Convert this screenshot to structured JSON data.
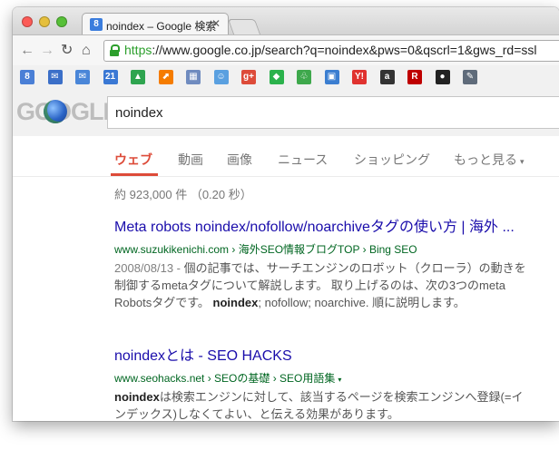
{
  "tab": {
    "title": "noindex – Google 検索",
    "favicon": "8",
    "close": "✕"
  },
  "omnibox": {
    "scheme": "https",
    "url_rest": "://www.google.co.jp/search?q=noindex&pws=0&qscrl=1&gws_rd=ssl"
  },
  "bookmarks": [
    {
      "icon": "g8-icon",
      "glyph": "8",
      "color": "#4a7fd6"
    },
    {
      "icon": "mail-icon",
      "glyph": "✉",
      "color": "#3b6fc8"
    },
    {
      "icon": "mail-icon",
      "glyph": "✉",
      "color": "#4a86d8"
    },
    {
      "icon": "calendar-icon",
      "glyph": "21",
      "color": "#3a78d4"
    },
    {
      "icon": "drive-icon",
      "glyph": "▲",
      "color": "#2ea44f"
    },
    {
      "icon": "analytics-icon",
      "glyph": "⬈",
      "color": "#f57c00"
    },
    {
      "icon": "tool-icon",
      "glyph": "▦",
      "color": "#6f8bbf"
    },
    {
      "icon": "user-icon",
      "glyph": "☺",
      "color": "#5aa0e0"
    },
    {
      "icon": "gplus-icon",
      "glyph": "g+",
      "color": "#dd4b39"
    },
    {
      "icon": "feedly-icon",
      "glyph": "◆",
      "color": "#2bb24c"
    },
    {
      "icon": "evernote-icon",
      "glyph": "♧",
      "color": "#3ea84c"
    },
    {
      "icon": "hatena-icon",
      "glyph": "▣",
      "color": "#3b7ed0"
    },
    {
      "icon": "yahoo-icon",
      "glyph": "Y!",
      "color": "#e0322f"
    },
    {
      "icon": "amazon-icon",
      "glyph": "a",
      "color": "#333333"
    },
    {
      "icon": "rakuten-icon",
      "glyph": "R",
      "color": "#bf0000"
    },
    {
      "icon": "app-icon",
      "glyph": "●",
      "color": "#222222"
    },
    {
      "icon": "pin-icon",
      "glyph": "✎",
      "color": "#5f6b7a"
    }
  ],
  "logo": {
    "text": "GOOGLE"
  },
  "search": {
    "query": "noindex"
  },
  "search_tabs": [
    {
      "label": "ウェブ",
      "active": true
    },
    {
      "label": "動画",
      "active": false
    },
    {
      "label": "画像",
      "active": false
    },
    {
      "label": "ニュース",
      "active": false
    },
    {
      "label": "ショッピング",
      "active": false
    },
    {
      "label": "もっと見る",
      "active": false
    }
  ],
  "more_chevron": "▾",
  "stats": "約 923,000 件 （0.20 秒）",
  "results": [
    {
      "title": "Meta robots noindex/nofollow/noarchiveタグの使い方 | 海外 ...",
      "url": "www.suzukikenichi.com › 海外SEO情報ブログTOP › Bing SEO",
      "date": "2008/08/13 - ",
      "snippet_a": "個の記事では、サーチエンジンのロボット（クローラ）の動きを制御するmetaタグについて解説します。 取り上げるのは、次の3つのmeta Robotsタグです。 ",
      "snippet_bold": "noindex",
      "snippet_b": "; nofollow; noarchive. 順に説明します。"
    },
    {
      "title": "noindexとは - SEO HACKS",
      "url": "www.seohacks.net › SEOの基礎 › SEO用語集",
      "url_menu": "▾",
      "snippet_bold": "noindex",
      "snippet_b": "は検索エンジンに対して、該当するページを検索エンジンへ登録(=インデックス)しなくてよい、と伝える効果があります。"
    }
  ]
}
